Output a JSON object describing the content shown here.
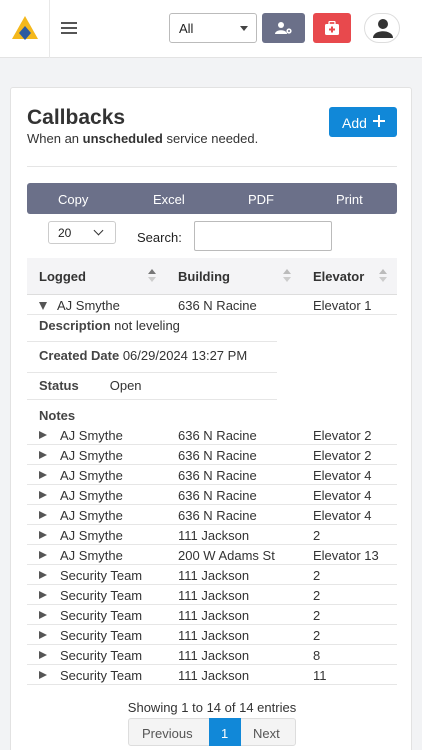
{
  "topbar": {
    "filter_value": "All"
  },
  "page": {
    "title": "Callbacks",
    "subtitle_pre": "When an ",
    "subtitle_bold": "unscheduled",
    "subtitle_post": " service needed.",
    "add_label": "Add"
  },
  "export": {
    "copy": "Copy",
    "excel": "Excel",
    "pdf": "PDF",
    "print": "Print"
  },
  "table_controls": {
    "page_length": "20",
    "search_label": "Search:",
    "search_value": ""
  },
  "columns": {
    "logged": "Logged",
    "building": "Building",
    "elevator": "Elevator"
  },
  "expanded_row": {
    "logged": "AJ Smythe",
    "building": "636 N Racine",
    "elevator": "Elevator 1",
    "description_label": "Description",
    "description_value": "not leveling",
    "created_label": "Created Date",
    "created_value": "06/29/2024 13:27 PM",
    "status_label": "Status",
    "status_value": "Open",
    "notes_label": "Notes"
  },
  "rows": [
    {
      "logged": "AJ Smythe",
      "building": "636 N Racine",
      "elevator": "Elevator 2"
    },
    {
      "logged": "AJ Smythe",
      "building": "636 N Racine",
      "elevator": "Elevator 2"
    },
    {
      "logged": "AJ Smythe",
      "building": "636 N Racine",
      "elevator": "Elevator 4"
    },
    {
      "logged": "AJ Smythe",
      "building": "636 N Racine",
      "elevator": "Elevator 4"
    },
    {
      "logged": "AJ Smythe",
      "building": "636 N Racine",
      "elevator": "Elevator 4"
    },
    {
      "logged": "AJ Smythe",
      "building": "111 Jackson",
      "elevator": "2"
    },
    {
      "logged": "AJ Smythe",
      "building": "200 W Adams St",
      "elevator": "Elevator 13"
    },
    {
      "logged": "Security Team",
      "building": "111 Jackson",
      "elevator": "2"
    },
    {
      "logged": "Security Team",
      "building": "111 Jackson",
      "elevator": "2"
    },
    {
      "logged": "Security Team",
      "building": "111 Jackson",
      "elevator": "2"
    },
    {
      "logged": "Security Team",
      "building": "111 Jackson",
      "elevator": "2"
    },
    {
      "logged": "Security Team",
      "building": "111 Jackson",
      "elevator": "8"
    },
    {
      "logged": "Security Team",
      "building": "111 Jackson",
      "elevator": "11"
    }
  ],
  "footer": {
    "info": "Showing 1 to 14 of 14 entries",
    "previous": "Previous",
    "current_page": "1",
    "next": "Next"
  },
  "colors": {
    "brand_blue": "#1188d8",
    "slate": "#6b7089",
    "danger": "#e8494d",
    "logo_gold": "#f4b81c"
  }
}
